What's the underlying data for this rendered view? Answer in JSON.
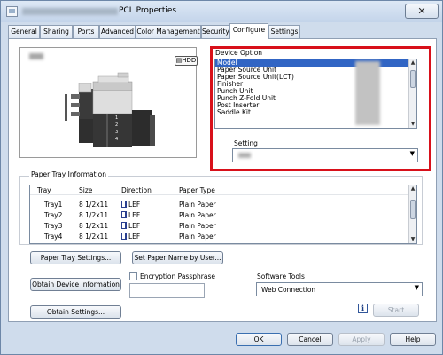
{
  "window": {
    "title": "PCL Properties",
    "close_label": "✕"
  },
  "tabs": [
    {
      "label": "General"
    },
    {
      "label": "Sharing"
    },
    {
      "label": "Ports"
    },
    {
      "label": "Advanced"
    },
    {
      "label": "Color Management"
    },
    {
      "label": "Security"
    },
    {
      "label": "Configure",
      "active": true
    },
    {
      "label": "Settings"
    }
  ],
  "preview": {
    "hdd_label": "HDD",
    "printer_icon": "printer-icon"
  },
  "device_option": {
    "label": "Device Option",
    "items": [
      "Model",
      "Paper Source Unit",
      "Paper Source Unit(LCT)",
      "Finisher",
      "Punch Unit",
      "Punch Z-Fold Unit",
      "Post Inserter",
      "Saddle Kit"
    ],
    "selected": "Model",
    "setting_label": "Setting"
  },
  "paper_tray": {
    "label": "Paper Tray Information",
    "columns": [
      "Tray",
      "Size",
      "Direction",
      "Paper Type"
    ],
    "rows": [
      {
        "tray": "Tray1",
        "size": "8 1/2x11",
        "direction": "LEF",
        "type": "Plain Paper"
      },
      {
        "tray": "Tray2",
        "size": "8 1/2x11",
        "direction": "LEF",
        "type": "Plain Paper"
      },
      {
        "tray": "Tray3",
        "size": "8 1/2x11",
        "direction": "LEF",
        "type": "Plain Paper"
      },
      {
        "tray": "Tray4",
        "size": "8 1/2x11",
        "direction": "LEF",
        "type": "Plain Paper"
      }
    ],
    "settings_button": "Paper Tray Settings...",
    "set_name_button": "Set Paper Name by User..."
  },
  "buttons": {
    "obtain_device": "Obtain Device Information",
    "obtain_settings": "Obtain Settings...",
    "start": "Start",
    "ok": "OK",
    "cancel": "Cancel",
    "apply": "Apply",
    "help": "Help"
  },
  "encryption": {
    "label": "Encryption Passphrase",
    "checked": false,
    "value": ""
  },
  "software_tools": {
    "label": "Software Tools",
    "value": "Web Connection"
  },
  "colors": {
    "accent": "#3165c4",
    "highlight_frame": "#d8101a",
    "window_bg": "#cfdcec"
  }
}
